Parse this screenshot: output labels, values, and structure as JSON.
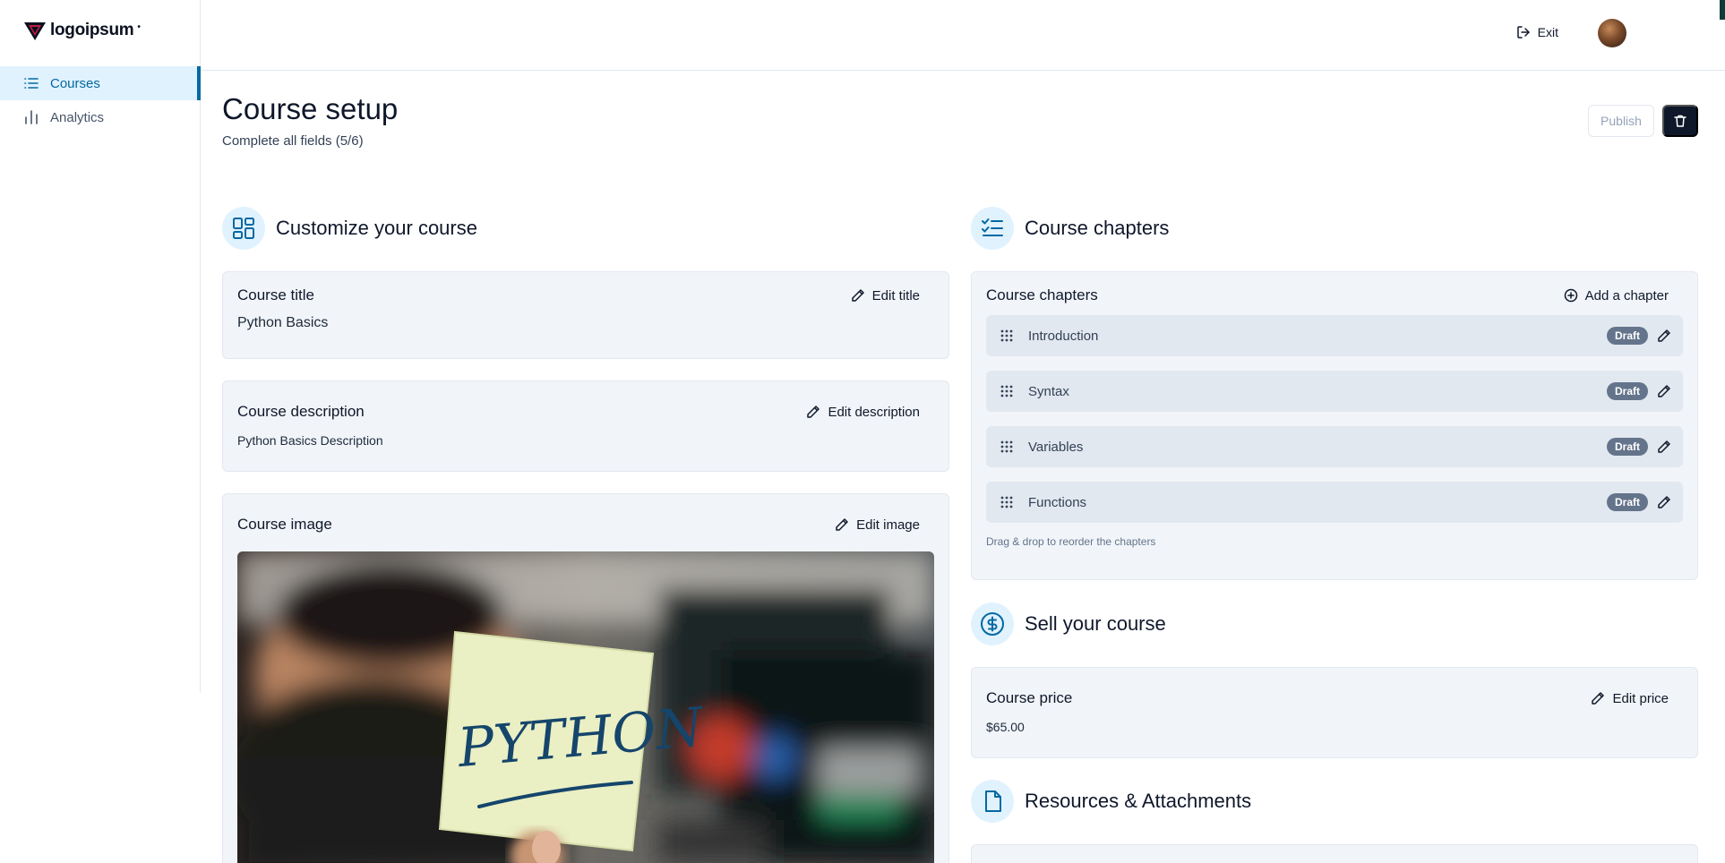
{
  "brand": {
    "name": "logoipsum"
  },
  "sidebar": {
    "items": [
      {
        "label": "Courses",
        "icon": "list-icon",
        "active": true
      },
      {
        "label": "Analytics",
        "icon": "bar-chart-icon",
        "active": false
      }
    ]
  },
  "header": {
    "exit_label": "Exit"
  },
  "page": {
    "title": "Course setup",
    "subtitle": "Complete all fields (5/6)",
    "publish_label": "Publish"
  },
  "customize": {
    "heading": "Customize your course",
    "title_card": {
      "label": "Course title",
      "action": "Edit title",
      "value": "Python Basics"
    },
    "description_card": {
      "label": "Course description",
      "action": "Edit description",
      "value": "Python Basics Description"
    },
    "image_card": {
      "label": "Course image",
      "action": "Edit image",
      "image_text": "PYTHON"
    }
  },
  "chapters": {
    "heading": "Course chapters",
    "card_label": "Course chapters",
    "add_label": "Add a chapter",
    "items": [
      {
        "title": "Introduction",
        "status": "Draft"
      },
      {
        "title": "Syntax",
        "status": "Draft"
      },
      {
        "title": "Variables",
        "status": "Draft"
      },
      {
        "title": "Functions",
        "status": "Draft"
      }
    ],
    "hint": "Drag & drop to reorder the chapters"
  },
  "sell": {
    "heading": "Sell your course",
    "price_card": {
      "label": "Course price",
      "action": "Edit price",
      "value": "$65.00"
    }
  },
  "resources": {
    "heading": "Resources & Attachments"
  },
  "colors": {
    "accent": "#0369a1",
    "accent_bg": "#e0f2fe",
    "card_bg": "#f1f5f9",
    "badge": "#64748b",
    "dark": "#0f172a"
  }
}
